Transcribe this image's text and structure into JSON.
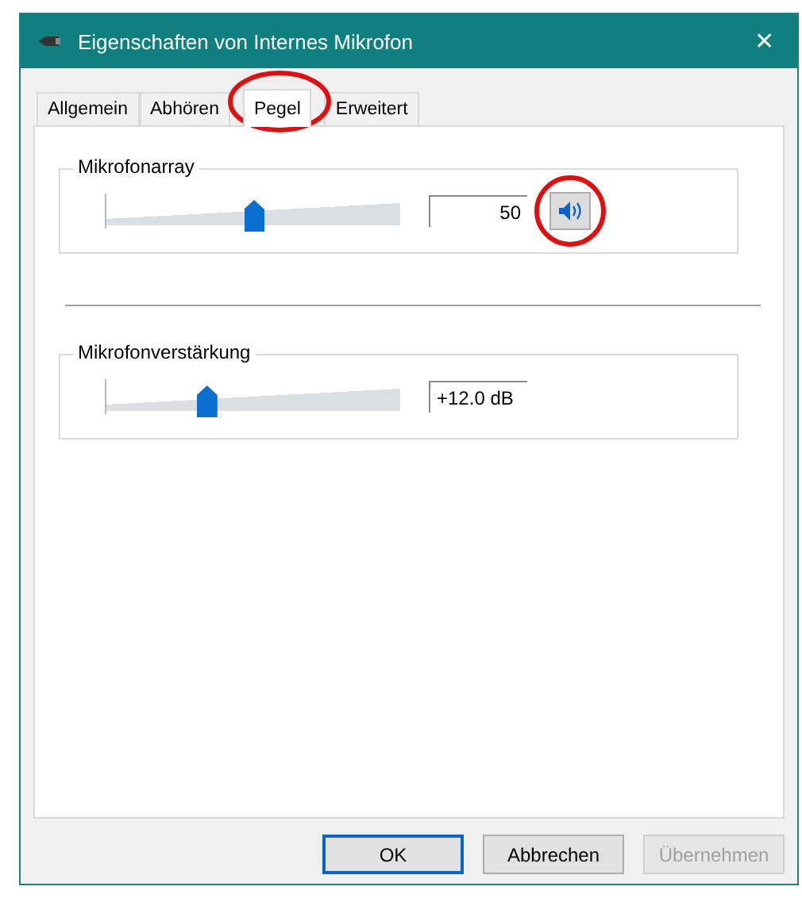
{
  "window": {
    "title": "Eigenschaften von Internes Mikrofon",
    "close": "✕"
  },
  "tabs": [
    {
      "label": "Allgemein",
      "selected": false,
      "circled": false
    },
    {
      "label": "Abhören",
      "selected": false,
      "circled": false
    },
    {
      "label": "Pegel",
      "selected": true,
      "circled": true
    },
    {
      "label": "Erweitert",
      "selected": false,
      "circled": false
    }
  ],
  "groups": [
    {
      "kind": "mute",
      "label": "Mikrofonarray",
      "level": 0.5,
      "value": "50",
      "muted": false,
      "circled": true
    },
    {
      "kind": "plain",
      "label": "Mikrofonverstärkung",
      "level": 0.34,
      "value": "+12.0 dB"
    }
  ],
  "buttons": [
    {
      "label": "OK",
      "default": true,
      "disabled": false
    },
    {
      "label": "Abbrechen",
      "default": false,
      "disabled": false
    },
    {
      "label": "Übernehmen",
      "default": false,
      "disabled": true
    }
  ]
}
